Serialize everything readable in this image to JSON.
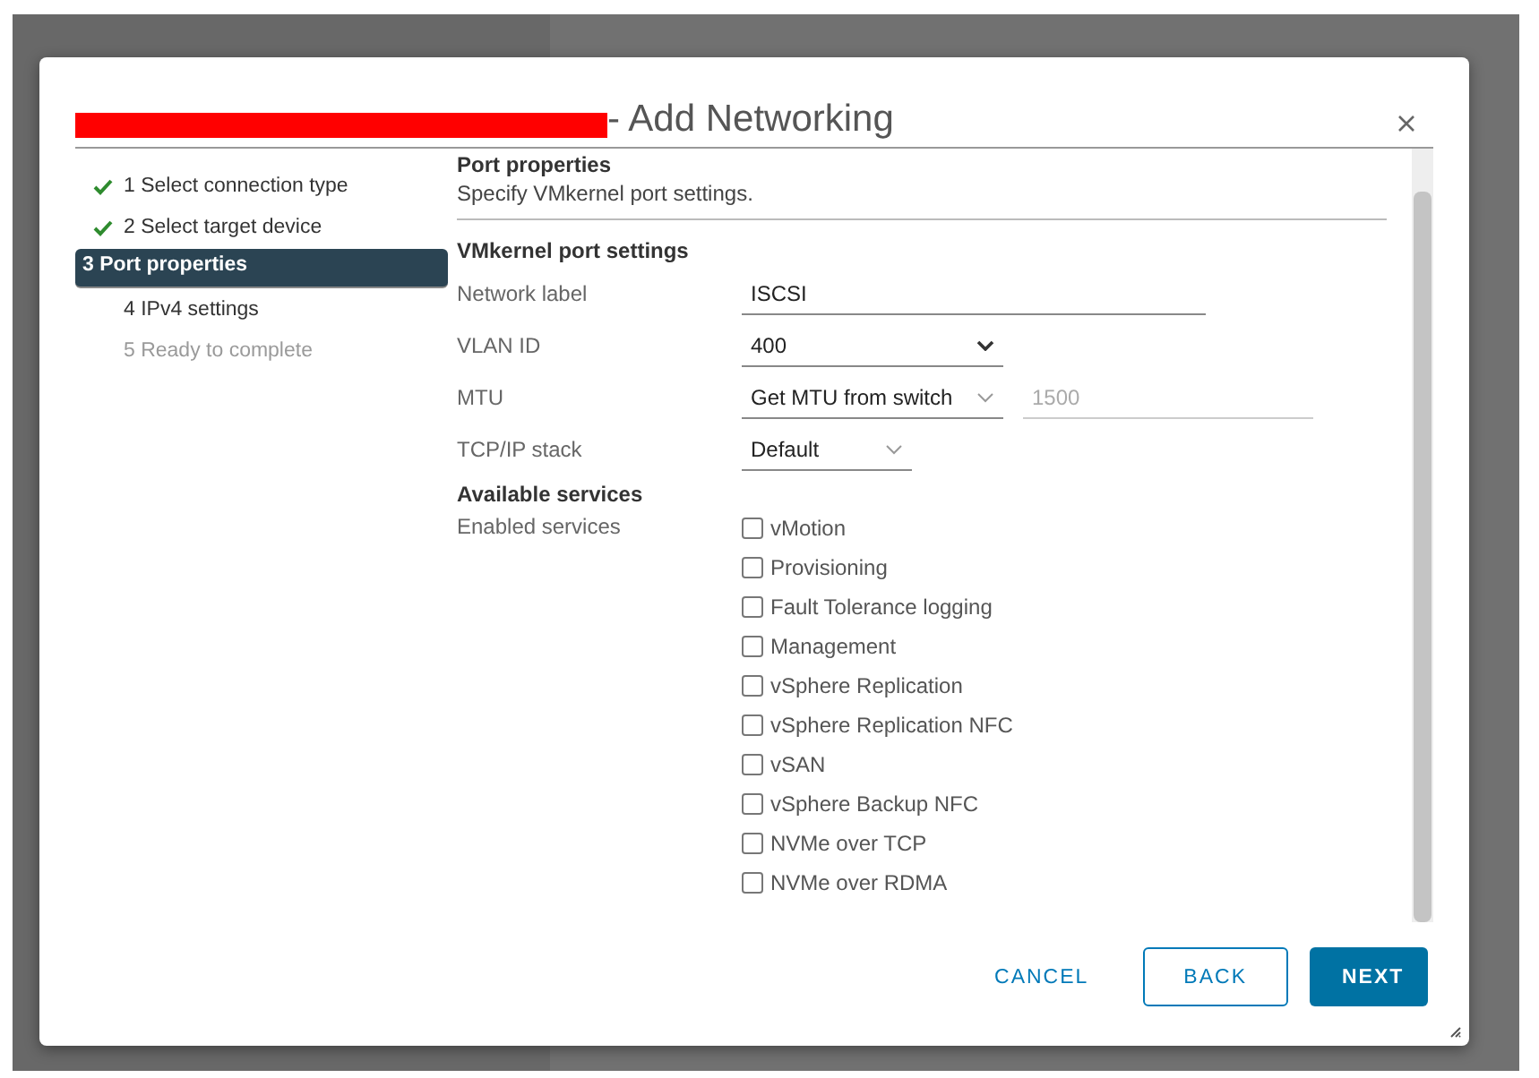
{
  "dialog": {
    "title": "- Add Networking",
    "title_redacted": true,
    "steps": [
      {
        "label": "1 Select connection type",
        "completed": true,
        "selected": false,
        "disabled": false
      },
      {
        "label": "2 Select target device",
        "completed": true,
        "selected": false,
        "disabled": false
      },
      {
        "label": "3 Port properties",
        "completed": false,
        "selected": true,
        "disabled": false
      },
      {
        "label": "4 IPv4 settings",
        "completed": false,
        "selected": false,
        "disabled": false
      },
      {
        "label": "5 Ready to complete",
        "completed": false,
        "selected": false,
        "disabled": true
      }
    ],
    "page_title": "Port properties",
    "page_description": "Specify VMkernel port settings.",
    "section_title": "VMkernel port settings",
    "fields": [
      {
        "kind": "text",
        "label": "Network label",
        "value": "ISCSI"
      },
      {
        "kind": "select",
        "label": "VLAN ID",
        "value": "400"
      },
      {
        "kind": "select-input",
        "label": "MTU",
        "value": "Get MTU from switch",
        "input_value": "1500",
        "input_disabled": true
      },
      {
        "kind": "select",
        "label": "TCP/IP stack",
        "value": "Default"
      }
    ],
    "services_title": "Available services",
    "services_label": "Enabled services",
    "services": [
      {
        "label": "vMotion",
        "checked": false
      },
      {
        "label": "Provisioning",
        "checked": false
      },
      {
        "label": "Fault Tolerance logging",
        "checked": false
      },
      {
        "label": "Management",
        "checked": false
      },
      {
        "label": "vSphere Replication",
        "checked": false
      },
      {
        "label": "vSphere Replication NFC",
        "checked": false
      },
      {
        "label": "vSAN",
        "checked": false
      },
      {
        "label": "vSphere Backup NFC",
        "checked": false
      },
      {
        "label": "NVMe over TCP",
        "checked": false
      },
      {
        "label": "NVMe over RDMA",
        "checked": false
      }
    ],
    "buttons": [
      {
        "kind": "flat",
        "label": "CANCEL"
      },
      {
        "kind": "outline",
        "label": "BACK"
      },
      {
        "kind": "primary",
        "label": "NEXT"
      }
    ]
  }
}
